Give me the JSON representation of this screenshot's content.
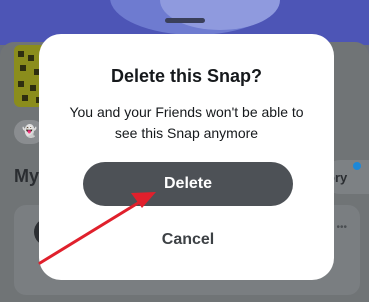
{
  "background": {
    "section_heading": "My",
    "story_button": "ory",
    "more_label": "•••"
  },
  "dialog": {
    "title": "Delete this Snap?",
    "message": "You and your Friends won't be able to see this Snap anymore",
    "delete_label": "Delete",
    "cancel_label": "Cancel"
  },
  "annotation": {
    "arrow_color": "#e0202c",
    "icon": "red-arrow-icon"
  },
  "colors": {
    "delete_button": "#4d5156",
    "notification_dot": "#1d88d8"
  }
}
